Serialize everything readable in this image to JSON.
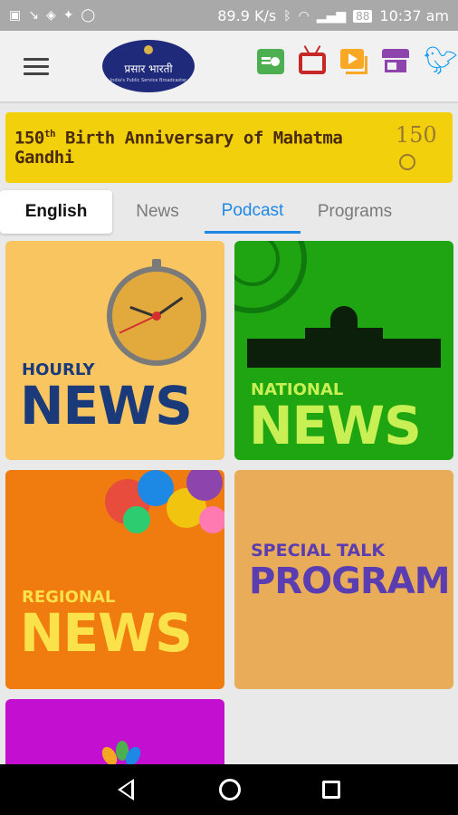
{
  "status_bar": {
    "speed": "89.9 K/s",
    "battery": "88",
    "time": "10:37 am"
  },
  "app_bar": {
    "logo_text": "प्रसार भारती",
    "logo_subtext": "India's Public Service Broadcaster",
    "icons": [
      "radio-icon",
      "tv-icon",
      "video-icon",
      "store-icon",
      "twitter-icon"
    ]
  },
  "banner": {
    "number": "150",
    "suffix": "th",
    "text": " Birth Anniversary of Mahatma Gandhi",
    "mark": "150"
  },
  "tabs": [
    {
      "label": "English",
      "active": false
    },
    {
      "label": "News",
      "active": false
    },
    {
      "label": "Podcast",
      "active": true
    },
    {
      "label": "Programs",
      "active": false
    }
  ],
  "cards": [
    {
      "top": "HOURLY",
      "big": "NEWS",
      "top_color": "#1a3a7a",
      "big_color": "#1a3a7a"
    },
    {
      "top": "NATIONAL",
      "big": "NEWS",
      "top_color": "#c8f055",
      "big_color": "#c8f055"
    },
    {
      "top": "REGIONAL",
      "big": "NEWS",
      "top_color": "#fbe14a",
      "big_color": "#fbe14a"
    },
    {
      "top": "SPECIAL TALK",
      "big": "PROGRAM",
      "top_color": "#5a3db0",
      "big_color": "#5a3db0"
    }
  ],
  "colors": {
    "accent": "#1e88e5",
    "banner": "#f2d00c"
  }
}
